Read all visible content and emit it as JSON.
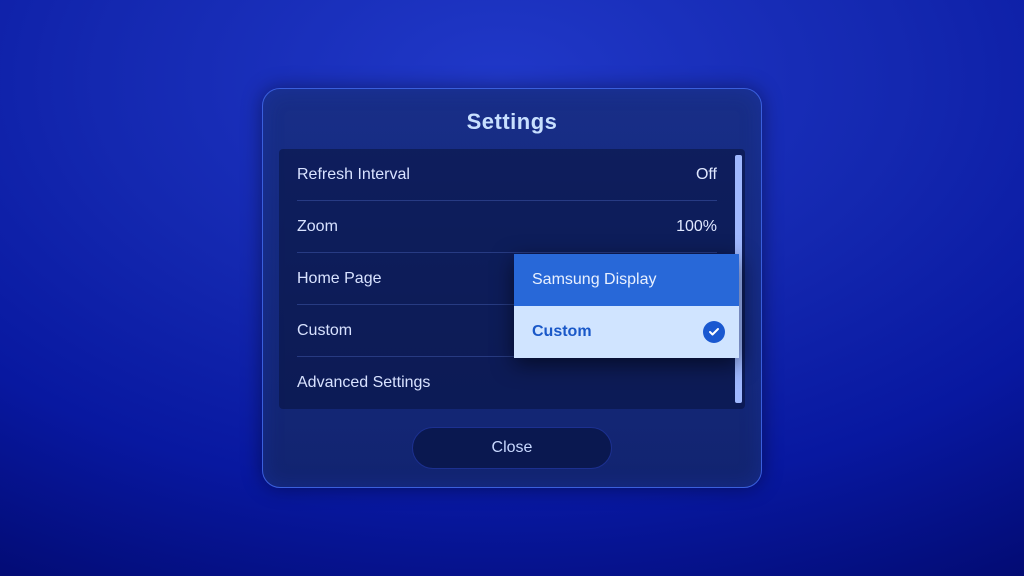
{
  "dialog": {
    "title": "Settings",
    "close_label": "Close"
  },
  "rows": {
    "refresh": {
      "label": "Refresh Interval",
      "value": "Off"
    },
    "zoom": {
      "label": "Zoom",
      "value": "100%"
    },
    "homepage": {
      "label": "Home Page"
    },
    "custom": {
      "label": "Custom"
    },
    "advanced": {
      "label": "Advanced Settings"
    }
  },
  "dropdown": {
    "options": [
      {
        "label": "Samsung Display",
        "selected": false
      },
      {
        "label": "Custom",
        "selected": true
      }
    ]
  }
}
